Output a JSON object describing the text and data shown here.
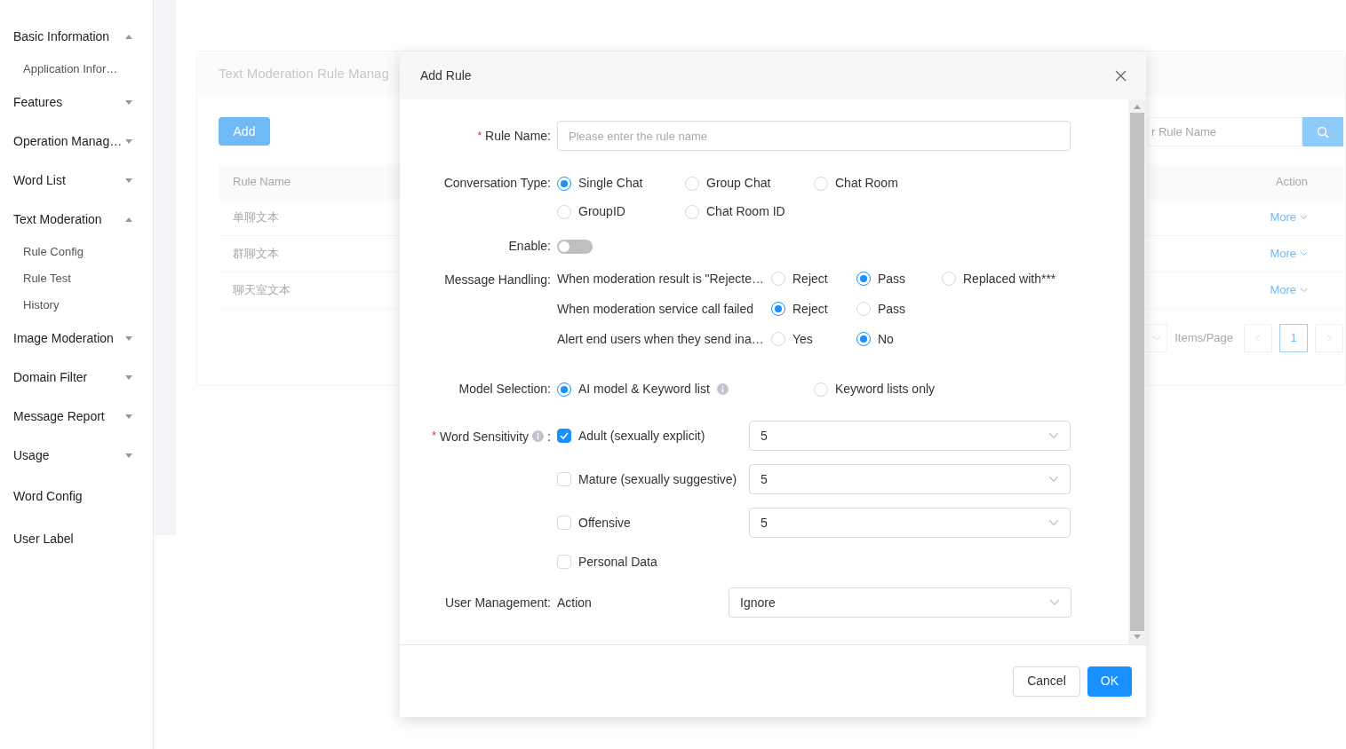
{
  "sidebar": {
    "items": [
      {
        "label": "Basic Information",
        "kind": "group",
        "expanded": true,
        "children": [
          {
            "label": "Application Infor…"
          }
        ]
      },
      {
        "label": "Features",
        "kind": "group",
        "expanded": false
      },
      {
        "label": "Operation Manag…",
        "kind": "group",
        "expanded": false
      },
      {
        "label": "Word List",
        "kind": "group",
        "expanded": false
      },
      {
        "label": "Text Moderation",
        "kind": "group",
        "expanded": true,
        "children": [
          {
            "label": "Rule Config"
          },
          {
            "label": "Rule Test"
          },
          {
            "label": "History"
          }
        ]
      },
      {
        "label": "Image Moderation",
        "kind": "group",
        "expanded": false
      },
      {
        "label": "Domain Filter",
        "kind": "group",
        "expanded": false
      },
      {
        "label": "Message Report",
        "kind": "group",
        "expanded": false
      },
      {
        "label": "Usage",
        "kind": "group",
        "expanded": false
      },
      {
        "label": "Word Config",
        "kind": "link"
      },
      {
        "label": "User Label",
        "kind": "link"
      }
    ]
  },
  "page": {
    "title": "Text Moderation Rule Manag",
    "add_button": "Add",
    "search": {
      "placeholder": "r Rule Name"
    },
    "table": {
      "columns": [
        "Rule Name",
        "Action"
      ],
      "rows": [
        {
          "name": "单聊文本",
          "action": "More"
        },
        {
          "name": "群聊文本",
          "action": "More"
        },
        {
          "name": "聊天室文本",
          "action": "More"
        }
      ]
    },
    "pagination": {
      "label": "Items/Page",
      "pages": [
        {
          "label": "1",
          "selected": true
        }
      ]
    }
  },
  "dialog": {
    "title": "Add Rule",
    "rule_name": {
      "label": "Rule Name:",
      "required_mark": "*",
      "placeholder": "Please enter the rule name"
    },
    "conversation_type": {
      "label": "Conversation Type:",
      "options": [
        {
          "label": "Single Chat",
          "selected": true
        },
        {
          "label": "Group Chat",
          "selected": false
        },
        {
          "label": "Chat Room",
          "selected": false
        },
        {
          "label": "GroupID",
          "selected": false
        },
        {
          "label": "Chat Room ID",
          "selected": false
        }
      ]
    },
    "enable": {
      "label": "Enable:",
      "on": false
    },
    "message_handling": {
      "label": "Message Handling:",
      "rows": [
        {
          "text": "When moderation result is \"Rejecte…",
          "options": [
            {
              "label": "Reject",
              "selected": false
            },
            {
              "label": "Pass",
              "selected": true
            },
            {
              "label": "Replaced with***",
              "selected": false
            }
          ]
        },
        {
          "text": "When moderation service call failed",
          "options": [
            {
              "label": "Reject",
              "selected": true
            },
            {
              "label": "Pass",
              "selected": false
            }
          ]
        },
        {
          "text": "Alert end users when they send ina…",
          "options": [
            {
              "label": "Yes",
              "selected": false
            },
            {
              "label": "No",
              "selected": true
            }
          ]
        }
      ]
    },
    "model_selection": {
      "label": "Model Selection:",
      "options": [
        {
          "label": "AI model & Keyword list",
          "selected": true,
          "info": true
        },
        {
          "label": "Keyword lists only",
          "selected": false
        }
      ]
    },
    "word_sensitivity": {
      "label": "Word Sensitivity",
      "required_mark": "*",
      "info": true,
      "label_suffix": ":",
      "items": [
        {
          "label": "Adult (sexually explicit)",
          "checked": true,
          "value": "5"
        },
        {
          "label": "Mature (sexually suggestive)",
          "checked": false,
          "value": "5"
        },
        {
          "label": "Offensive",
          "checked": false,
          "value": "5"
        },
        {
          "label": "Personal Data",
          "checked": false
        }
      ]
    },
    "user_management": {
      "label": "User Management:",
      "text": "Action",
      "value": "Ignore"
    },
    "buttons": [
      {
        "label": "Cancel",
        "kind": "secondary"
      },
      {
        "label": "OK",
        "kind": "primary"
      }
    ]
  }
}
